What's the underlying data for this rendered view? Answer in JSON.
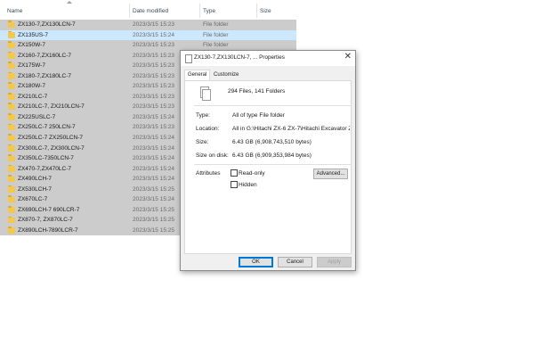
{
  "columns": {
    "name": "Name",
    "date": "Date modified",
    "type": "Type",
    "size": "Size"
  },
  "rows": [
    {
      "name": "ZX130-7,ZX130LCN-7",
      "date": "2023/3/15 15:23",
      "type": "File folder"
    },
    {
      "name": "ZX135US-7",
      "date": "2023/3/15 15:24",
      "type": "File folder"
    },
    {
      "name": "ZX150W-7",
      "date": "2023/3/15 15:23",
      "type": "File folder"
    },
    {
      "name": "ZX160-7,ZX160LC-7",
      "date": "2023/3/15 15:23",
      "type": ""
    },
    {
      "name": "ZX175W-7",
      "date": "2023/3/15 15:23",
      "type": ""
    },
    {
      "name": "ZX180-7,ZX180LC-7",
      "date": "2023/3/15 15:23",
      "type": ""
    },
    {
      "name": "ZX180W-7",
      "date": "2023/3/15 15:23",
      "type": ""
    },
    {
      "name": "ZX210LC-7",
      "date": "2023/3/15 15:23",
      "type": ""
    },
    {
      "name": "ZX210LC-7, ZX210LCN-7",
      "date": "2023/3/15 15:23",
      "type": ""
    },
    {
      "name": "ZX225USLC-7",
      "date": "2023/3/15 15:24",
      "type": ""
    },
    {
      "name": "ZX250LC-7 250LCN-7",
      "date": "2023/3/15 15:23",
      "type": ""
    },
    {
      "name": "ZX250LC-7 ZX250LCN-7",
      "date": "2023/3/15 15:24",
      "type": ""
    },
    {
      "name": "ZX300LC-7, ZX300LCN-7",
      "date": "2023/3/15 15:24",
      "type": ""
    },
    {
      "name": "ZX350LC-7350LCN-7",
      "date": "2023/3/15 15:24",
      "type": ""
    },
    {
      "name": "ZX470-7,ZX470LC-7",
      "date": "2023/3/15 15:24",
      "type": ""
    },
    {
      "name": "ZX490LCH-7",
      "date": "2023/3/15 15:24",
      "type": ""
    },
    {
      "name": "ZX530LCH-7",
      "date": "2023/3/15 15:25",
      "type": ""
    },
    {
      "name": "ZX670LC-7",
      "date": "2023/3/15 15:24",
      "type": ""
    },
    {
      "name": "ZX690LCH-7 690LCR-7",
      "date": "2023/3/15 15:25",
      "type": ""
    },
    {
      "name": "ZX870-7, ZX870LC-7",
      "date": "2023/3/15 15:25",
      "type": ""
    },
    {
      "name": "ZX890LCH-7890LCR-7",
      "date": "2023/3/15 15:25",
      "type": ""
    }
  ],
  "dialog": {
    "title": "ZX130-7,ZX130LCN-7, ... Properties",
    "tabs": [
      "General",
      "Customize"
    ],
    "summary": "294 Files, 141 Folders",
    "fields": [
      {
        "label": "Type:",
        "value": "All of type File folder"
      },
      {
        "label": "Location:",
        "value": "All in G:\\Hitachi ZX-6 ZX-7\\Hitachi Excavator ZX-7 2"
      },
      {
        "label": "Size:",
        "value": "6.43 GB (6,908,743,510 bytes)"
      },
      {
        "label": "Size on disk:",
        "value": "6.43 GB (6,909,353,984 bytes)"
      }
    ],
    "attributes_label": "Attributes",
    "readonly_label": "Read-only",
    "hidden_label": "Hidden",
    "advanced_label": "Advanced...",
    "ok_label": "OK",
    "cancel_label": "Cancel",
    "apply_label": "Apply"
  },
  "icons": {
    "folder": "folder-icon",
    "files": "files-icon",
    "close": "close-icon",
    "sort": "sort-arrow-icon"
  },
  "colors": {
    "selection": "#cce8ff",
    "row_bg": "#cccccc",
    "folder": "#f4c84a",
    "accent": "#0078d7"
  }
}
